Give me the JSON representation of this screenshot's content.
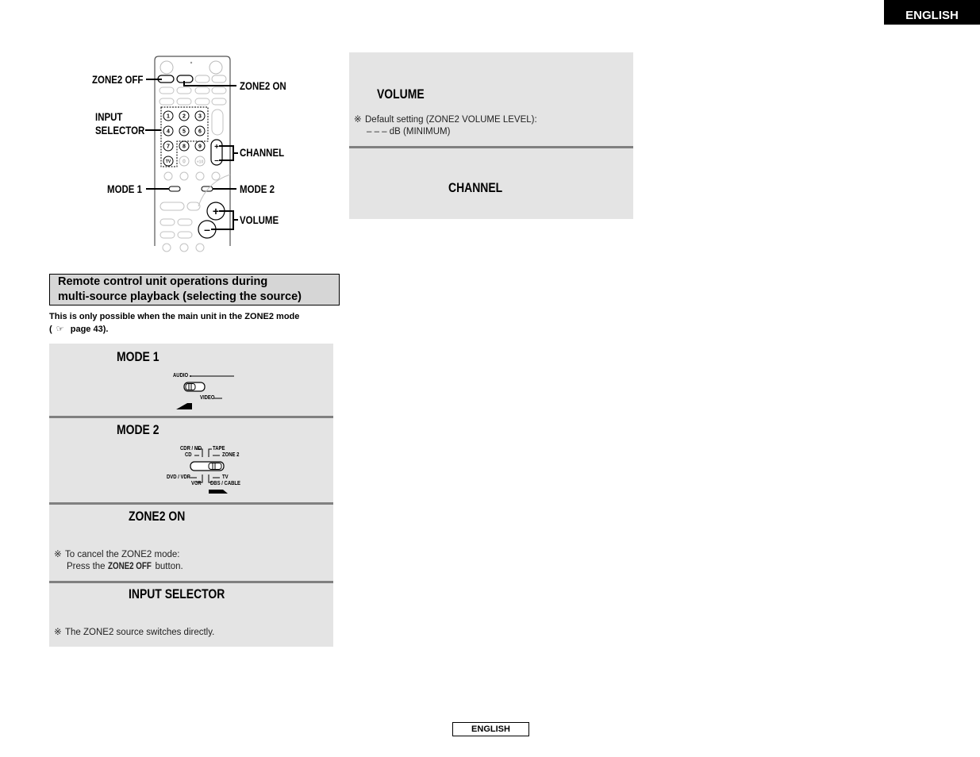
{
  "header": {
    "language_tab": "ENGLISH"
  },
  "remote_diagram": {
    "callouts": {
      "zone2_off": "ZONE2 OFF",
      "zone2_on": "ZONE2 ON",
      "input_selector_line1": "INPUT",
      "input_selector_line2": "SELECTOR",
      "channel": "CHANNEL",
      "mode1": "MODE 1",
      "mode2": "MODE 2",
      "volume": "VOLUME"
    },
    "keypad": [
      "1",
      "2",
      "3",
      "4",
      "5",
      "6",
      "7",
      "8",
      "9"
    ],
    "extra_keys": [
      "0",
      "+10"
    ]
  },
  "section": {
    "heading_line1": "Remote control unit operations during",
    "heading_line2": "multi-source playback (selecting the source)",
    "intro_line1": "This is only possible when the main unit in the ZONE2 mode",
    "intro_line2_prefix": "(",
    "intro_line2_icon": "page-reference-icon",
    "intro_line2_text": " page 43)."
  },
  "steps_left": [
    {
      "title": "MODE 1",
      "switch_labels": {
        "audio": "AUDIO",
        "video": "VIDEO"
      }
    },
    {
      "title": "MODE 2",
      "switch_labels": {
        "cdr_md": "CDR / MD",
        "cd": "CD",
        "tape": "TAPE",
        "zone2": "ZONE 2",
        "dvd_vdp": "DVD / VDP",
        "vcr": "VCR",
        "tv": "TV",
        "dbs_cable": "DBS / CABLE"
      }
    },
    {
      "title": "ZONE2 ON",
      "note_mark": "※",
      "note_line1": "To cancel the ZONE2 mode:",
      "note_line2_prefix": "Press the ",
      "note_line2_bold": "ZONE2 OFF",
      "note_line2_suffix": " button."
    },
    {
      "title": "INPUT SELECTOR",
      "note_mark": "※",
      "note_line1": "The ZONE2 source switches directly."
    }
  ],
  "steps_right": [
    {
      "title": "VOLUME",
      "note_mark": "※",
      "note_line1": "Default setting (ZONE2 VOLUME LEVEL):",
      "note_line2": "– – – dB (MINIMUM)"
    },
    {
      "title": "CHANNEL"
    }
  ],
  "footer": {
    "language_label": "ENGLISH"
  }
}
